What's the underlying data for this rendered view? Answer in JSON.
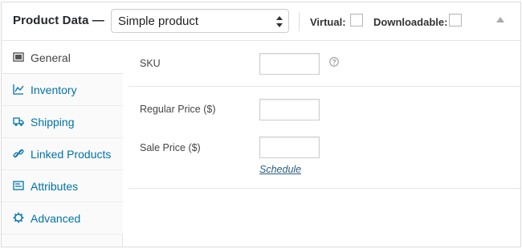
{
  "header": {
    "title": "Product Data —",
    "product_type": {
      "selected": "Simple product"
    },
    "virtual_label": "Virtual:",
    "downloadable_label": "Downloadable:",
    "virtual_checked": false,
    "downloadable_checked": false
  },
  "tabs": [
    {
      "label": "General",
      "icon": "general-icon",
      "active": true
    },
    {
      "label": "Inventory",
      "icon": "inventory-icon",
      "active": false
    },
    {
      "label": "Shipping",
      "icon": "truck-icon",
      "active": false
    },
    {
      "label": "Linked Products",
      "icon": "link-icon",
      "active": false
    },
    {
      "label": "Attributes",
      "icon": "attributes-icon",
      "active": false
    },
    {
      "label": "Advanced",
      "icon": "gear-icon",
      "active": false
    }
  ],
  "general": {
    "sku_label": "SKU",
    "sku_value": "",
    "regular_price_label": "Regular Price ($)",
    "regular_price_value": "",
    "sale_price_label": "Sale Price ($)",
    "sale_price_value": "",
    "schedule_link": "Schedule"
  },
  "colors": {
    "link": "#0073aa",
    "border": "#dcdcdc",
    "tab_bg": "#fafafa"
  }
}
